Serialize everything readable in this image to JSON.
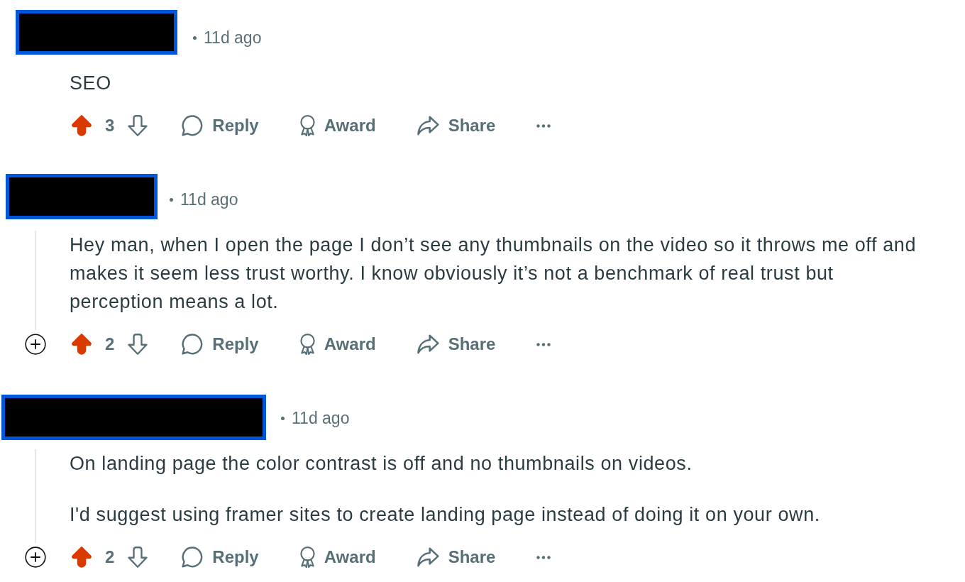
{
  "comments": [
    {
      "time": "11d ago",
      "body": [
        "SEO"
      ],
      "upvoted": true,
      "downvoted": false,
      "score": "3",
      "expandable": false,
      "actions": [
        {
          "kind": "reply",
          "label": "Reply"
        },
        {
          "kind": "award",
          "label": "Award"
        },
        {
          "kind": "share",
          "label": "Share"
        }
      ]
    },
    {
      "time": "11d ago",
      "body": [
        "Hey man, when I open the page I don’t see any thumbnails on the video so it throws me off and makes it seem less trust worthy. I know obviously it’s not a benchmark of real trust but perception means a lot."
      ],
      "upvoted": true,
      "downvoted": false,
      "score": "2",
      "expandable": true,
      "actions": [
        {
          "kind": "reply",
          "label": "Reply"
        },
        {
          "kind": "award",
          "label": "Award"
        },
        {
          "kind": "share",
          "label": "Share"
        }
      ]
    },
    {
      "time": "11d ago",
      "body": [
        "On landing page the color contrast is off and no thumbnails on videos.",
        "I'd suggest using framer sites to create landing page instead of doing it on your own."
      ],
      "upvoted": true,
      "downvoted": false,
      "score": "2",
      "expandable": true,
      "actions": [
        {
          "kind": "reply",
          "label": "Reply"
        },
        {
          "kind": "award",
          "label": "Award"
        },
        {
          "kind": "share",
          "label": "Share"
        }
      ]
    }
  ]
}
